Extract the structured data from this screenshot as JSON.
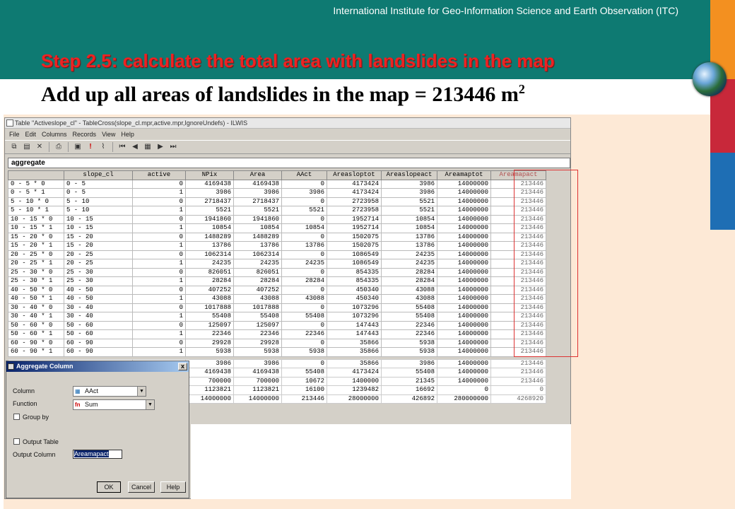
{
  "header": {
    "institution": "International Institute for Geo-Information Science and Earth Observation (ITC)",
    "step_title": "Step 2.5: calculate the total area with landslides in the map",
    "subtitle": "Add up all areas of landslides in the map = 213446 m",
    "subtitle_sup": "2"
  },
  "colors": {
    "header_bg": "#0e7a72",
    "bar_orange": "#f39020",
    "bar_red": "#c8283a",
    "bar_blue": "#1e6eb4",
    "step_red": "#ee2222"
  },
  "window": {
    "title": "Table \"Activeslope_cl\" - TableCross(slope_cl.mpr,active.mpr,IgnoreUndefs) - ILWIS",
    "menu": [
      "File",
      "Edit",
      "Columns",
      "Records",
      "View",
      "Help"
    ],
    "command": "aggregate",
    "columns": [
      "",
      "slope_cl",
      "active",
      "NPix",
      "Area",
      "AAct",
      "Areasloptot",
      "Areaslopeact",
      "Areamaptot",
      "Areamapact"
    ],
    "rows": [
      [
        "0 - 5 * 0",
        "0 - 5",
        "0",
        "4169438",
        "4169438",
        "0",
        "4173424",
        "3986",
        "14000000",
        "213446"
      ],
      [
        "0 - 5 * 1",
        "0 - 5",
        "1",
        "3986",
        "3986",
        "3986",
        "4173424",
        "3986",
        "14000000",
        "213446"
      ],
      [
        "5 - 10 * 0",
        "5 - 10",
        "0",
        "2718437",
        "2718437",
        "0",
        "2723958",
        "5521",
        "14000000",
        "213446"
      ],
      [
        "5 - 10 * 1",
        "5 - 10",
        "1",
        "5521",
        "5521",
        "5521",
        "2723958",
        "5521",
        "14000000",
        "213446"
      ],
      [
        "10 - 15 * 0",
        "10 - 15",
        "0",
        "1941860",
        "1941860",
        "0",
        "1952714",
        "10854",
        "14000000",
        "213446"
      ],
      [
        "10 - 15 * 1",
        "10 - 15",
        "1",
        "10854",
        "10854",
        "10854",
        "1952714",
        "10854",
        "14000000",
        "213446"
      ],
      [
        "15 - 20 * 0",
        "15 - 20",
        "0",
        "1488289",
        "1488289",
        "0",
        "1502075",
        "13786",
        "14000000",
        "213446"
      ],
      [
        "15 - 20 * 1",
        "15 - 20",
        "1",
        "13786",
        "13786",
        "13786",
        "1502075",
        "13786",
        "14000000",
        "213446"
      ],
      [
        "20 - 25 * 0",
        "20 - 25",
        "0",
        "1062314",
        "1062314",
        "0",
        "1086549",
        "24235",
        "14000000",
        "213446"
      ],
      [
        "20 - 25 * 1",
        "20 - 25",
        "1",
        "24235",
        "24235",
        "24235",
        "1086549",
        "24235",
        "14000000",
        "213446"
      ],
      [
        "25 - 30 * 0",
        "25 - 30",
        "0",
        "826051",
        "826051",
        "0",
        "854335",
        "28284",
        "14000000",
        "213446"
      ],
      [
        "25 - 30 * 1",
        "25 - 30",
        "1",
        "28284",
        "28284",
        "28284",
        "854335",
        "28284",
        "14000000",
        "213446"
      ],
      [
        "40 - 50 * 0",
        "40 - 50",
        "0",
        "407252",
        "407252",
        "0",
        "450340",
        "43088",
        "14000000",
        "213446"
      ],
      [
        "40 - 50 * 1",
        "40 - 50",
        "1",
        "43088",
        "43088",
        "43088",
        "450340",
        "43088",
        "14000000",
        "213446"
      ],
      [
        "30 - 40 * 0",
        "30 - 40",
        "0",
        "1017888",
        "1017888",
        "0",
        "1073296",
        "55408",
        "14000000",
        "213446"
      ],
      [
        "30 - 40 * 1",
        "30 - 40",
        "1",
        "55408",
        "55408",
        "55408",
        "1073296",
        "55408",
        "14000000",
        "213446"
      ],
      [
        "50 - 60 * 0",
        "50 - 60",
        "0",
        "125097",
        "125097",
        "0",
        "147443",
        "22346",
        "14000000",
        "213446"
      ],
      [
        "50 - 60 * 1",
        "50 - 60",
        "1",
        "22346",
        "22346",
        "22346",
        "147443",
        "22346",
        "14000000",
        "213446"
      ],
      [
        "60 - 90 * 0",
        "60 - 90",
        "0",
        "29928",
        "29928",
        "0",
        "35866",
        "5938",
        "14000000",
        "213446"
      ],
      [
        "60 - 90 * 1",
        "60 - 90",
        "1",
        "5938",
        "5938",
        "5938",
        "35866",
        "5938",
        "14000000",
        "213446"
      ]
    ],
    "summary": [
      [
        "",
        "",
        "",
        "3986",
        "3986",
        "0",
        "35866",
        "3986",
        "14000000",
        "213446"
      ],
      [
        "",
        "",
        "",
        "4169438",
        "4169438",
        "55408",
        "4173424",
        "55408",
        "14000000",
        "213446"
      ],
      [
        "",
        "",
        "",
        "700000",
        "700000",
        "10672",
        "1400000",
        "21345",
        "14000000",
        "213446"
      ],
      [
        "",
        "",
        "",
        "1123821",
        "1123821",
        "16100",
        "1239482",
        "16692",
        "0",
        "0"
      ],
      [
        "",
        "",
        "",
        "14000000",
        "14000000",
        "213446",
        "28000000",
        "426892",
        "280000000",
        "4268920"
      ]
    ]
  },
  "dialog": {
    "title": "Aggregate Column",
    "column_label": "Column",
    "column_value": "AAct",
    "function_label": "Function",
    "function_value": "Sum",
    "function_prefix": "fn",
    "group_by": "Group by",
    "output_table": "Output Table",
    "output_column_label": "Output Column",
    "output_column_value": "Areamapact",
    "ok": "OK",
    "cancel": "Cancel",
    "help": "Help",
    "close": "x"
  }
}
